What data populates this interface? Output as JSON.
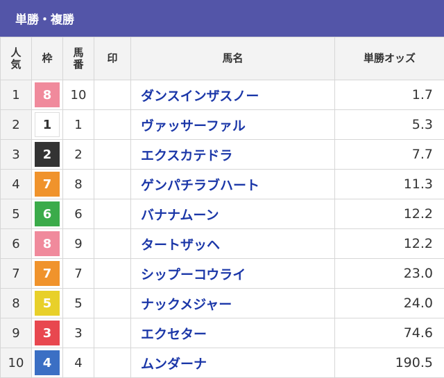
{
  "header": {
    "title": "単勝・複勝"
  },
  "table": {
    "headers": {
      "popularity": [
        "人",
        "気"
      ],
      "waku": "枠",
      "umaban": [
        "馬",
        "番"
      ],
      "mark": "印",
      "name": "馬名",
      "odds": "単勝オッズ"
    },
    "rows": [
      {
        "pop": "1",
        "waku": "8",
        "num": "10",
        "name": "ダンスインザスノー",
        "odds": "1.7"
      },
      {
        "pop": "2",
        "waku": "1",
        "num": "1",
        "name": "ヴァッサーファル",
        "odds": "5.3"
      },
      {
        "pop": "3",
        "waku": "2",
        "num": "2",
        "name": "エクスカテドラ",
        "odds": "7.7"
      },
      {
        "pop": "4",
        "waku": "7",
        "num": "8",
        "name": "ゲンパチラブハート",
        "odds": "11.3"
      },
      {
        "pop": "5",
        "waku": "6",
        "num": "6",
        "name": "バナナムーン",
        "odds": "12.2"
      },
      {
        "pop": "6",
        "waku": "8",
        "num": "9",
        "name": "タートザッヘ",
        "odds": "12.2"
      },
      {
        "pop": "7",
        "waku": "7",
        "num": "7",
        "name": "シップーコウライ",
        "odds": "23.0"
      },
      {
        "pop": "8",
        "waku": "5",
        "num": "5",
        "name": "ナックメジャー",
        "odds": "24.0"
      },
      {
        "pop": "9",
        "waku": "3",
        "num": "3",
        "name": "エクセター",
        "odds": "74.6"
      },
      {
        "pop": "10",
        "waku": "4",
        "num": "4",
        "name": "ムンダーナ",
        "odds": "190.5"
      }
    ]
  },
  "waku_colors": {
    "1": {
      "bg": "#ffffff",
      "fg": "#333333",
      "border": "#dddddd"
    },
    "2": {
      "bg": "#333333",
      "fg": "#ffffff"
    },
    "3": {
      "bg": "#e8474f",
      "fg": "#ffffff"
    },
    "4": {
      "bg": "#3b6fc4",
      "fg": "#ffffff"
    },
    "5": {
      "bg": "#e8d02a",
      "fg": "#ffffff"
    },
    "6": {
      "bg": "#3bab4a",
      "fg": "#ffffff"
    },
    "7": {
      "bg": "#f0932c",
      "fg": "#ffffff"
    },
    "8": {
      "bg": "#f08a9c",
      "fg": "#ffffff"
    }
  }
}
